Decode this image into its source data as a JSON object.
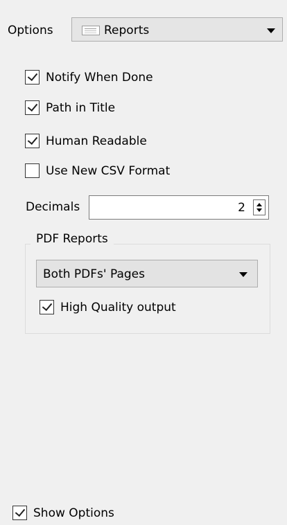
{
  "options": {
    "label": "Options",
    "selected": "Reports",
    "icon": "document-icon"
  },
  "checkboxes": [
    {
      "label": "Notify When Done",
      "checked": true
    },
    {
      "label": "Path in Title",
      "checked": true
    },
    {
      "label": "Human Readable",
      "checked": true
    },
    {
      "label": "Use New CSV Format",
      "checked": false
    }
  ],
  "decimals": {
    "label": "Decimals",
    "value": "2"
  },
  "pdf_reports": {
    "title": "PDF Reports",
    "selected": "Both PDFs' Pages",
    "high_quality_label": "High Quality output",
    "high_quality_checked": true
  },
  "show_options": {
    "label": "Show Options",
    "checked": true
  }
}
